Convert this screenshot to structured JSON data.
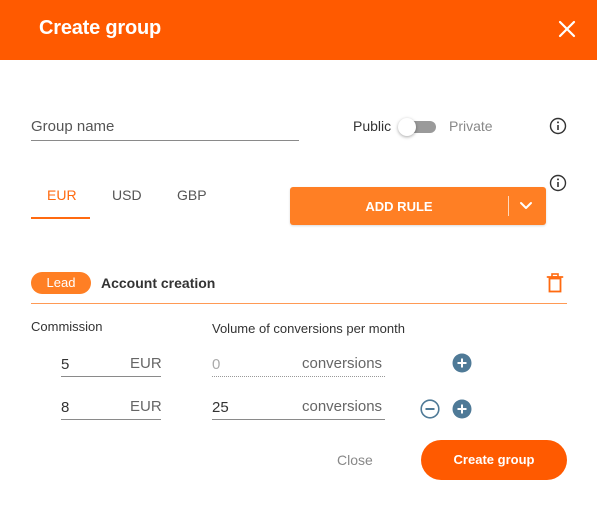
{
  "header": {
    "title": "Create group",
    "close_icon": "close-x-icon"
  },
  "group_name": {
    "placeholder": "Group name",
    "value": ""
  },
  "visibility": {
    "left_label": "Public",
    "right_label": "Private",
    "selected": "Public"
  },
  "currency_tabs": [
    {
      "label": "EUR",
      "active": true
    },
    {
      "label": "USD",
      "active": false
    },
    {
      "label": "GBP",
      "active": false
    }
  ],
  "add_rule": {
    "label": "ADD RULE"
  },
  "rule": {
    "badge": "Lead",
    "name": "Account creation",
    "commission_header": "Commission",
    "volume_header": "Volume of conversions per month",
    "rows": [
      {
        "commission": "5",
        "currency": "EUR",
        "conversions": "",
        "conversions_placeholder": "0",
        "unit": "conversions"
      },
      {
        "commission": "8",
        "currency": "EUR",
        "conversions": "25",
        "conversions_placeholder": "",
        "unit": "conversions"
      }
    ]
  },
  "footer": {
    "close_label": "Close",
    "create_label": "Create group"
  },
  "colors": {
    "accent": "#ff5a00",
    "accent_light": "#ff7f24",
    "icon_blue": "#4f7a97"
  }
}
